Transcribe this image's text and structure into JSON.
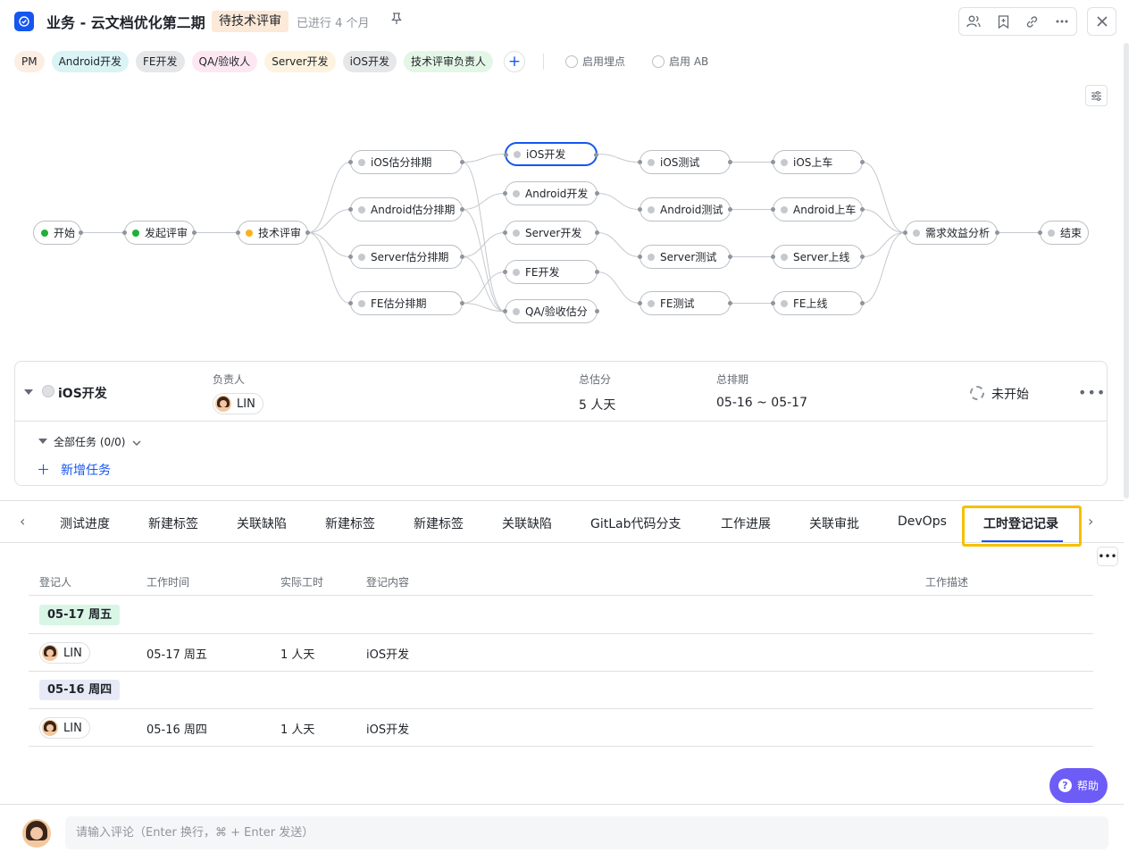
{
  "header": {
    "title": "业务 - 云文档优化第二期",
    "status": "待技术评审",
    "elapsed": "已进行 4 个月"
  },
  "roles": [
    {
      "label": "PM",
      "color": "#fdeee3"
    },
    {
      "label": "Android开发",
      "color": "#daf3f4"
    },
    {
      "label": "FE开发",
      "color": "#e6e7e9"
    },
    {
      "label": "QA/验收人",
      "color": "#fde8f1"
    },
    {
      "label": "Server开发",
      "color": "#fdf3df"
    },
    {
      "label": "iOS开发",
      "color": "#e6e7e9"
    },
    {
      "label": "技术评审负责人",
      "color": "#e4f6e6"
    }
  ],
  "toggles": {
    "tracking": "启用埋点",
    "ab": "启用 AB"
  },
  "flow": {
    "nodes": [
      {
        "id": "start",
        "label": "开始",
        "dot": "#1fb03a"
      },
      {
        "id": "review_start",
        "label": "发起评审",
        "dot": "#1fb03a"
      },
      {
        "id": "tech_review",
        "label": "技术评审",
        "dot": "#f5b321"
      },
      {
        "id": "ios_est",
        "label": "iOS估分排期"
      },
      {
        "id": "android_est",
        "label": "Android估分排期"
      },
      {
        "id": "server_est",
        "label": "Server估分排期"
      },
      {
        "id": "fe_est",
        "label": "FE估分排期"
      },
      {
        "id": "ios_dev",
        "label": "iOS开发"
      },
      {
        "id": "android_dev",
        "label": "Android开发"
      },
      {
        "id": "server_dev",
        "label": "Server开发"
      },
      {
        "id": "fe_dev",
        "label": "FE开发"
      },
      {
        "id": "qa_est",
        "label": "QA/验收估分"
      },
      {
        "id": "ios_test",
        "label": "iOS测试"
      },
      {
        "id": "android_test",
        "label": "Android测试"
      },
      {
        "id": "server_test",
        "label": "Server测试"
      },
      {
        "id": "fe_test",
        "label": "FE测试"
      },
      {
        "id": "ios_release",
        "label": "iOS上车"
      },
      {
        "id": "android_release",
        "label": "Android上车"
      },
      {
        "id": "server_release",
        "label": "Server上线"
      },
      {
        "id": "fe_release",
        "label": "FE上线"
      },
      {
        "id": "benefit",
        "label": "需求效益分析"
      },
      {
        "id": "end",
        "label": "结束"
      }
    ],
    "selected": "ios_dev"
  },
  "task": {
    "name": "iOS开发",
    "owner_label": "负责人",
    "owner": "LIN",
    "estimate_label": "总估分",
    "estimate": "5 人天",
    "schedule_label": "总排期",
    "schedule": "05-16 ~ 05-17",
    "status": "未开始",
    "subtasks": "全部任务 (0/0)",
    "add_task": "新增任务"
  },
  "tabs": [
    "测试进度",
    "新建标签",
    "关联缺陷",
    "新建标签",
    "新建标签",
    "关联缺陷",
    "GitLab代码分支",
    "工作进展",
    "关联审批",
    "DevOps",
    "工时登记记录"
  ],
  "active_tab": "工时登记记录",
  "table": {
    "headers": {
      "person": "登记人",
      "work_time": "工作时间",
      "actual": "实际工时",
      "content": "登记内容",
      "desc": "工作描述"
    },
    "groups": [
      {
        "date": "05-17 周五",
        "badge_color": "#d9f5e6",
        "rows": [
          {
            "person": "LIN",
            "work_time": "05-17 周五",
            "actual": "1 人天",
            "content": "iOS开发",
            "desc": ""
          }
        ]
      },
      {
        "date": "05-16 周四",
        "badge_color": "#e7eaf6",
        "rows": [
          {
            "person": "LIN",
            "work_time": "05-16 周四",
            "actual": "1 人天",
            "content": "iOS开发",
            "desc": ""
          }
        ]
      }
    ]
  },
  "help": "帮助",
  "comment": {
    "placeholder": "请输入评论（Enter 换行，⌘ + Enter 发送）"
  }
}
